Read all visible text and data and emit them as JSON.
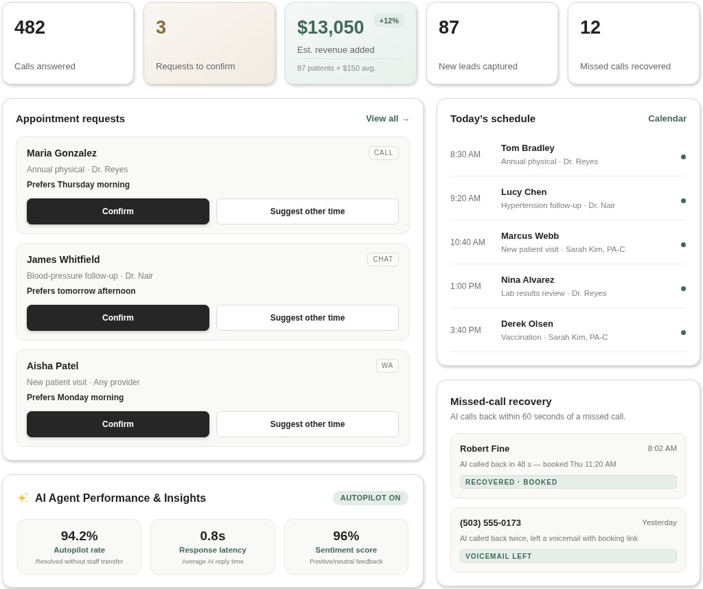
{
  "stats": [
    {
      "kind": "plain",
      "value": "482",
      "label": "Calls answered"
    },
    {
      "kind": "pending",
      "value": "3",
      "label": "Requests to confirm"
    },
    {
      "kind": "revenue",
      "value": "$13,050",
      "badge": "+12%",
      "label": "Est. revenue added",
      "note": "87 patients × $150 avg."
    },
    {
      "kind": "plain",
      "value": "87",
      "label": "New leads captured"
    },
    {
      "kind": "plain",
      "value": "12",
      "label": "Missed calls recovered"
    }
  ],
  "appointment_requests": {
    "title": "Appointment requests",
    "link": "View all →",
    "requests": [
      {
        "name": "Maria Gonzalez",
        "detail": "Annual physical · Dr. Reyes",
        "preference": "Prefers Thursday morning",
        "channel": "CALL",
        "actions": [
          {
            "kind": "primary",
            "label": "Confirm"
          },
          {
            "kind": "secondary",
            "label": "Suggest other time"
          }
        ]
      },
      {
        "name": "James Whitfield",
        "detail": "Blood-pressure follow-up · Dr. Nair",
        "preference": "Prefers tomorrow afternoon",
        "channel": "CHAT",
        "actions": [
          {
            "kind": "primary",
            "label": "Confirm"
          },
          {
            "kind": "secondary",
            "label": "Suggest other time"
          }
        ]
      },
      {
        "name": "Aisha Patel",
        "detail": "New patient visit · Any provider",
        "preference": "Prefers Monday morning",
        "channel": "WA",
        "actions": [
          {
            "kind": "primary",
            "label": "Confirm"
          },
          {
            "kind": "secondary",
            "label": "Suggest other time"
          }
        ]
      }
    ]
  },
  "ai_performance": {
    "title": "AI Agent Performance & Insights",
    "badge": "AUTOPILOT ON",
    "metrics": [
      {
        "value": "94.2%",
        "label": "Autopilot rate",
        "caption": "Resolved without staff transfer"
      },
      {
        "value": "0.8s",
        "label": "Response latency",
        "caption": "Average AI reply time"
      },
      {
        "value": "96%",
        "label": "Sentiment score",
        "caption": "Positive/neutral feedback"
      }
    ]
  },
  "schedule": {
    "title": "Today’s schedule",
    "link": "Calendar",
    "items": [
      {
        "time": "8:30 AM",
        "name": "Tom Bradley",
        "detail": "Annual physical · Dr. Reyes"
      },
      {
        "time": "9:20 AM",
        "name": "Lucy Chen",
        "detail": "Hypertension follow-up · Dr. Nair"
      },
      {
        "time": "10:40 AM",
        "name": "Marcus Webb",
        "detail": "New patient visit · Sarah Kim, PA-C"
      },
      {
        "time": "1:00 PM",
        "name": "Nina Alvarez",
        "detail": "Lab results review · Dr. Reyes"
      },
      {
        "time": "3:40 PM",
        "name": "Derek Olsen",
        "detail": "Vaccination · Sarah Kim, PA-C"
      }
    ]
  },
  "missed_calls": {
    "title": "Missed-call recovery",
    "subtitle": "AI calls back within 60 seconds of a missed call.",
    "items": [
      {
        "caller": "Robert Fine",
        "time": "8:02 AM",
        "detail": "AI called back in 48 s — booked Thu 11:20 AM",
        "status": "RECOVERED · BOOKED"
      },
      {
        "caller": "(503) 555-0173",
        "time": "Yesterday",
        "detail": "AI called back twice, left a voicemail with booking link",
        "status": "VOICEMAIL LEFT"
      }
    ]
  }
}
